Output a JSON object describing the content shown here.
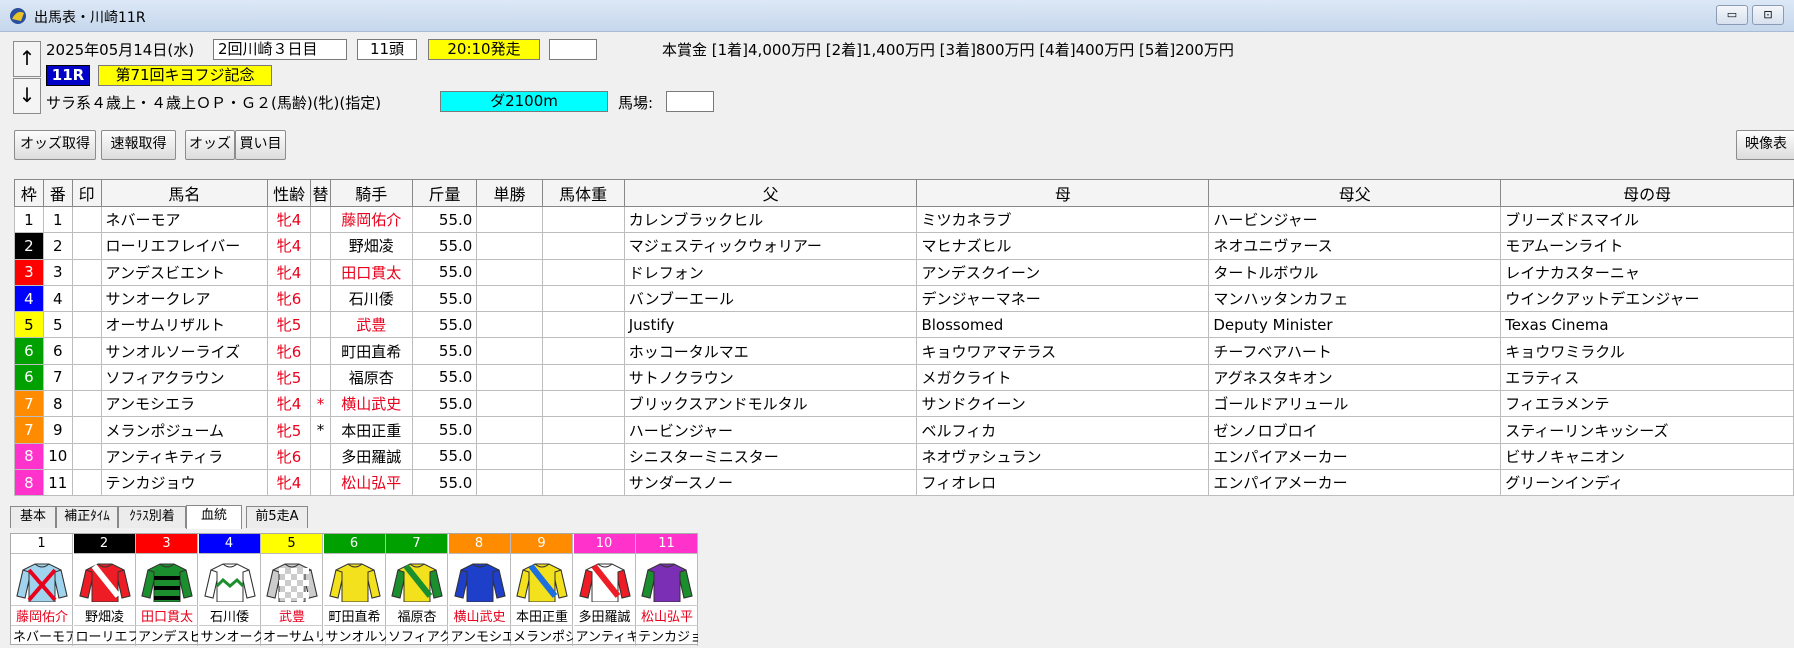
{
  "window": {
    "title": "出馬表・川崎11R",
    "min_btn": "▭",
    "max_btn": "⊡"
  },
  "header": {
    "date": "2025年05月14日(水)",
    "meeting": "2回川崎３日目",
    "runners": "11頭",
    "post_time": "20:10発走",
    "race_no": "11R",
    "race_name": "第71回キヨフジ記念",
    "conditions": "サラ系４歳上・４歳上ＯＰ・Ｇ２(馬齢)(牝)(指定)",
    "course": "ダ2100m",
    "track_label": "馬場:",
    "prize": "本賞金 [1着]4,000万円 [2着]1,400万円 [3着]800万円 [4着]400万円 [5着]200万円",
    "up": "↑",
    "down": "↓"
  },
  "toolbar": {
    "odds_fetch": "オッズ取得",
    "flash_fetch": "速報取得",
    "odds": "オッズ",
    "bets": "買い目",
    "video": "映像表"
  },
  "table": {
    "headers": [
      "枠",
      "番",
      "印",
      "馬名",
      "性齢",
      "替",
      "騎手",
      "斤量",
      "単勝",
      "馬体重",
      "父",
      "母",
      "母父",
      "母の母"
    ],
    "rows": [
      {
        "waku": "1",
        "num": "1",
        "name": "ネバーモア",
        "sex": "牝4",
        "change": "",
        "jockey": "藤岡佑介",
        "jred": true,
        "weight": "55.0",
        "sire": "カレンブラックヒル",
        "dam": "ミツカネラブ",
        "bms": "ハービンジャー",
        "damdam": "ブリーズドスマイル"
      },
      {
        "waku": "2",
        "num": "2",
        "name": "ローリエフレイバー",
        "sex": "牝4",
        "change": "",
        "jockey": "野畑凌",
        "jred": false,
        "weight": "55.0",
        "sire": "マジェスティックウォリアー",
        "dam": "マヒナズヒル",
        "bms": "ネオユニヴァース",
        "damdam": "モアムーンライト"
      },
      {
        "waku": "3",
        "num": "3",
        "name": "アンデスビエント",
        "sex": "牝4",
        "change": "",
        "jockey": "田口貫太",
        "jred": true,
        "weight": "55.0",
        "sire": "ドレフォン",
        "dam": "アンデスクイーン",
        "bms": "タートルボウル",
        "damdam": "レイナカスターニャ"
      },
      {
        "waku": "4",
        "num": "4",
        "name": "サンオークレア",
        "sex": "牝6",
        "change": "",
        "jockey": "石川倭",
        "jred": false,
        "weight": "55.0",
        "sire": "バンブーエール",
        "dam": "デンジャーマネー",
        "bms": "マンハッタンカフェ",
        "damdam": "ウインクアットデエンジャー"
      },
      {
        "waku": "5",
        "num": "5",
        "name": "オーサムリザルト",
        "sex": "牝5",
        "change": "",
        "jockey": "武豊",
        "jred": true,
        "weight": "55.0",
        "sire": "Justify",
        "dam": "Blossomed",
        "bms": "Deputy Minister",
        "damdam": "Texas Cinema"
      },
      {
        "waku": "6",
        "num": "6",
        "name": "サンオルソーライズ",
        "sex": "牝6",
        "change": "",
        "jockey": "町田直希",
        "jred": false,
        "weight": "55.0",
        "sire": "ホッコータルマエ",
        "dam": "キョウワアマテラス",
        "bms": "チーフベアハート",
        "damdam": "キョウワミラクル"
      },
      {
        "waku": "6",
        "num": "7",
        "name": "ソフィアクラウン",
        "sex": "牝5",
        "change": "",
        "jockey": "福原杏",
        "jred": false,
        "weight": "55.0",
        "sire": "サトノクラウン",
        "dam": "メガクライト",
        "bms": "アグネスタキオン",
        "damdam": "エラティス"
      },
      {
        "waku": "7",
        "num": "8",
        "name": "アンモシエラ",
        "sex": "牝4",
        "change": "*",
        "jockey": "横山武史",
        "jred": true,
        "weight": "55.0",
        "sire": "ブリックスアンドモルタル",
        "dam": "サンドクイーン",
        "bms": "ゴールドアリュール",
        "damdam": "フィエラメンテ"
      },
      {
        "waku": "7",
        "num": "9",
        "name": "メランポジューム",
        "sex": "牝5",
        "change": "*",
        "jockey": "本田正重",
        "jred": false,
        "weight": "55.0",
        "sire": "ハービンジャー",
        "dam": "ベルフィカ",
        "bms": "ゼンノロブロイ",
        "damdam": "スティーリンキッシーズ"
      },
      {
        "waku": "8",
        "num": "10",
        "name": "アンティキティラ",
        "sex": "牝6",
        "change": "",
        "jockey": "多田羅誠",
        "jred": false,
        "weight": "55.0",
        "sire": "シニスターミニスター",
        "dam": "ネオヴァシュラン",
        "bms": "エンパイアメーカー",
        "damdam": "ビサノキャニオン"
      },
      {
        "waku": "8",
        "num": "11",
        "name": "テンカジョウ",
        "sex": "牝4",
        "change": "",
        "jockey": "松山弘平",
        "jred": true,
        "weight": "55.0",
        "sire": "サンダースノー",
        "dam": "フィオレロ",
        "bms": "エンパイアメーカー",
        "damdam": "グリーンインディ"
      }
    ]
  },
  "waku_colors": {
    "1": "#ffffff",
    "2": "#000000",
    "3": "#ff0000",
    "4": "#0000ff",
    "5": "#ffff00",
    "6": "#00a000",
    "7": "#ff8c00",
    "8": "#ff33cc"
  },
  "tabs": [
    "基本",
    "補正ﾀｲﾑ",
    "ｸﾗｽ別着",
    "血統",
    "前5走A"
  ],
  "active_tab": "血統",
  "silks": [
    {
      "num": "1",
      "jockey": "藤岡佑介",
      "jred": true,
      "horse": "ネバーモア",
      "bg": "#ffffff",
      "body": "#9fd3ee",
      "sleeve": "#9fd3ee",
      "mark": "cross"
    },
    {
      "num": "2",
      "jockey": "野畑凌",
      "jred": false,
      "horse": "ローリエフレイバー",
      "bg": "#000000",
      "body": "#ee1c24",
      "sleeve": "#ee1c24",
      "mark": "sash-white"
    },
    {
      "num": "3",
      "jockey": "田口貫太",
      "jred": true,
      "horse": "アンデスビエント",
      "bg": "#ff0000",
      "body": "#1b8f2e",
      "sleeve": "#1b8f2e",
      "mark": "hoops-black"
    },
    {
      "num": "4",
      "jockey": "石川倭",
      "jred": false,
      "horse": "サンオークレア",
      "bg": "#0000ff",
      "body": "#ffffff",
      "sleeve": "#ffffff",
      "mark": "zigzag-green"
    },
    {
      "num": "5",
      "jockey": "武豊",
      "jred": true,
      "horse": "オーサムリザルト",
      "bg": "#ffff00",
      "body": "#cccccc",
      "sleeve": "#cccccc",
      "mark": "check"
    },
    {
      "num": "6",
      "jockey": "町田直希",
      "jred": false,
      "horse": "サンオルソーライズ",
      "bg": "#00a000",
      "body": "#f2e11c",
      "sleeve": "#f2e11c",
      "mark": "none"
    },
    {
      "num": "7",
      "jockey": "福原杏",
      "jred": false,
      "horse": "ソフィアクラウン",
      "bg": "#00a000",
      "body": "#f2e11c",
      "sleeve": "#1b8f2e",
      "mark": "sash-green"
    },
    {
      "num": "8",
      "jockey": "横山武史",
      "jred": true,
      "horse": "アンモシエラ",
      "bg": "#ff8c00",
      "body": "#1d3fc9",
      "sleeve": "#1d3fc9",
      "mark": "none"
    },
    {
      "num": "9",
      "jockey": "本田正重",
      "jred": false,
      "horse": "メランポジューム",
      "bg": "#ff8c00",
      "body": "#f2e11c",
      "sleeve": "#f2e11c",
      "mark": "sash-blue"
    },
    {
      "num": "10",
      "jockey": "多田羅誠",
      "jred": false,
      "horse": "アンティキティラ",
      "bg": "#ff33cc",
      "body": "#ffffff",
      "sleeve": "#ee1c24",
      "mark": "sash-red"
    },
    {
      "num": "11",
      "jockey": "松山弘平",
      "jred": true,
      "horse": "テンカジョウ",
      "bg": "#ff33cc",
      "body": "#7b2fb5",
      "sleeve": "#1b8f2e",
      "mark": "none"
    }
  ]
}
